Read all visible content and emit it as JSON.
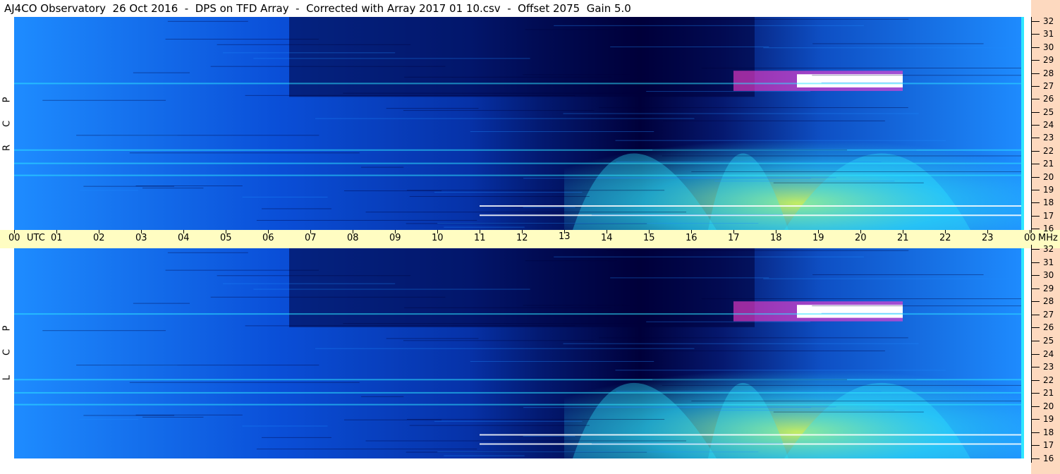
{
  "header": {
    "title": "AJ4CO Observatory  26 Oct 2016  -  DPS on TFD Array  -  Corrected with Array 2017 01 10.csv  -  Offset 2075  Gain 5.0"
  },
  "panels": [
    {
      "id": "rcp",
      "letters": [
        "R",
        "C",
        "P"
      ]
    },
    {
      "id": "lcp",
      "letters": [
        "L",
        "C",
        "P"
      ]
    }
  ],
  "colors": {
    "background_dark": "#00003a",
    "background_mid": "#0a4fd8",
    "background_light": "#1e8cff",
    "cyan": "#2ee6ff",
    "yellow_green": "#d7ff5a",
    "magenta": "#ff3ecf",
    "white": "#ffffff",
    "axis_strip": "#fffdc2",
    "side_strip": "#fdd9bf"
  },
  "chart_data": {
    "type": "heatmap",
    "title": "AJ4CO Observatory  26 Oct 2016  -  DPS on TFD Array  -  Corrected with Array 2017 01 10.csv  -  Offset 2075  Gain 5.0",
    "x_tick_labels": [
      "00",
      "01",
      "02",
      "03",
      "04",
      "05",
      "06",
      "07",
      "08",
      "09",
      "10",
      "11",
      "12",
      "13",
      "14",
      "15",
      "16",
      "17",
      "18",
      "19",
      "20",
      "21",
      "22",
      "23",
      "00"
    ],
    "x_unit_label": "UTC",
    "y_unit_label": "MHz",
    "xlim": [
      0,
      24
    ],
    "ylim": [
      16,
      32
    ],
    "y_ticks": [
      16,
      17,
      18,
      19,
      20,
      21,
      22,
      23,
      24,
      25,
      26,
      27,
      28,
      29,
      30,
      31,
      32
    ],
    "series": [
      {
        "name": "RCP",
        "letters": [
          "R",
          "C",
          "P"
        ]
      },
      {
        "name": "LCP",
        "letters": [
          "L",
          "C",
          "P"
        ]
      }
    ],
    "features": {
      "night_dark_region_hours": [
        6.5,
        17.5
      ],
      "bright_band_hours": [
        18.5,
        21.0
      ],
      "bright_band_mhz": [
        26.6,
        27.8
      ],
      "green_region_hours": [
        13.0,
        24.0
      ],
      "green_region_mhz": [
        16.0,
        24.0
      ],
      "rfi_lines_mhz": [
        27.0,
        20.1,
        17.8,
        17.1,
        21.0,
        22.0
      ],
      "burst_arcs": [
        {
          "start": 13.2,
          "peak": 14.4,
          "end": 16.6
        },
        {
          "start": 16.4,
          "peak": 17.1,
          "end": 18.3
        },
        {
          "start": 18.2,
          "peak": 20.6,
          "end": 22.6
        }
      ]
    }
  }
}
